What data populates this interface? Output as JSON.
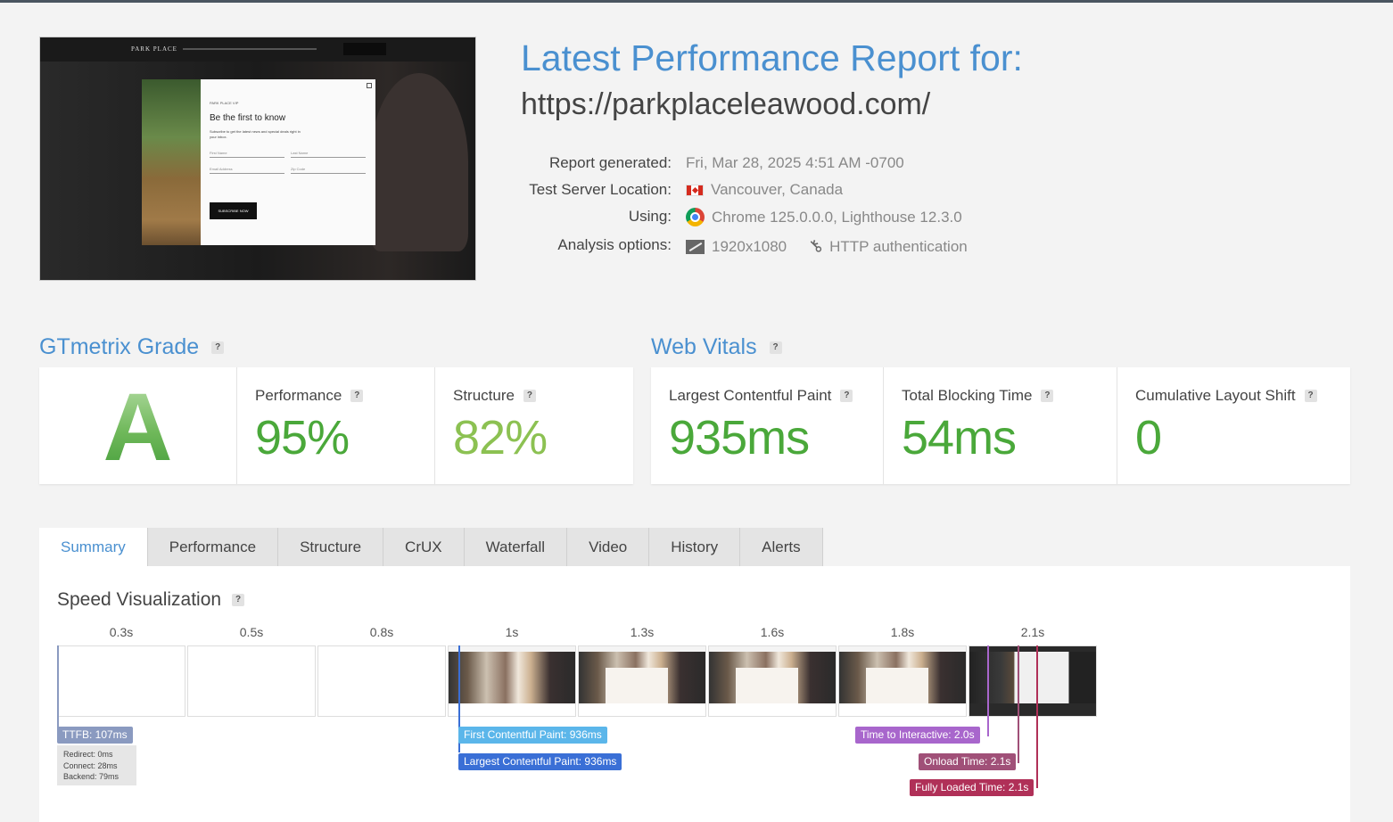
{
  "report": {
    "title": "Latest Performance Report for:",
    "url": "https://parkplaceleawood.com/",
    "generated_label": "Report generated:",
    "generated_value": "Fri, Mar 28, 2025 4:51 AM -0700",
    "location_label": "Test Server Location:",
    "location_value": "Vancouver, Canada",
    "using_label": "Using:",
    "using_value": "Chrome 125.0.0.0, Lighthouse 12.3.0",
    "options_label": "Analysis options:",
    "options_resolution": "1920x1080",
    "options_auth": "HTTP authentication"
  },
  "thumbnail": {
    "brand": "PARK PLACE",
    "modal_label": "PARK PLACE VIP",
    "modal_title": "Be the first to know",
    "modal_text": "Subscribe to get the latest news and special deals right in your inbox.",
    "first_name": "First Name",
    "last_name": "Last Name",
    "email": "Email Address",
    "zip": "Zip Code",
    "subscribe": "SUBSCRIBE NOW"
  },
  "grade": {
    "heading": "GTmetrix Grade",
    "letter": "A",
    "performance_label": "Performance",
    "performance_value": "95%",
    "structure_label": "Structure",
    "structure_value": "82%"
  },
  "vitals": {
    "heading": "Web Vitals",
    "lcp_label": "Largest Contentful Paint",
    "lcp_value": "935ms",
    "tbt_label": "Total Blocking Time",
    "tbt_value": "54ms",
    "cls_label": "Cumulative Layout Shift",
    "cls_value": "0"
  },
  "tabs": [
    "Summary",
    "Performance",
    "Structure",
    "CrUX",
    "Waterfall",
    "Video",
    "History",
    "Alerts"
  ],
  "speed": {
    "title": "Speed Visualization",
    "ticks": [
      "0.3s",
      "0.5s",
      "0.8s",
      "1s",
      "1.3s",
      "1.6s",
      "1.8s",
      "2.1s"
    ],
    "ttfb": "TTFB: 107ms",
    "redirect": "Redirect: 0ms",
    "connect": "Connect: 28ms",
    "backend": "Backend: 79ms",
    "fcp": "First Contentful Paint: 936ms",
    "lcp": "Largest Contentful Paint: 936ms",
    "tti": "Time to Interactive: 2.0s",
    "onload": "Onload Time: 2.1s",
    "fully_loaded": "Fully Loaded Time: 2.1s"
  },
  "colors": {
    "accent": "#4a90d0",
    "performance_green": "#4aa83a",
    "structure_green": "#8cc152",
    "ttfb": "#8a9ac0",
    "fcp": "#5bb6ea",
    "lcp": "#3a6fd6",
    "tti": "#a866cc",
    "onload": "#a05078",
    "fully_loaded": "#b03058"
  }
}
